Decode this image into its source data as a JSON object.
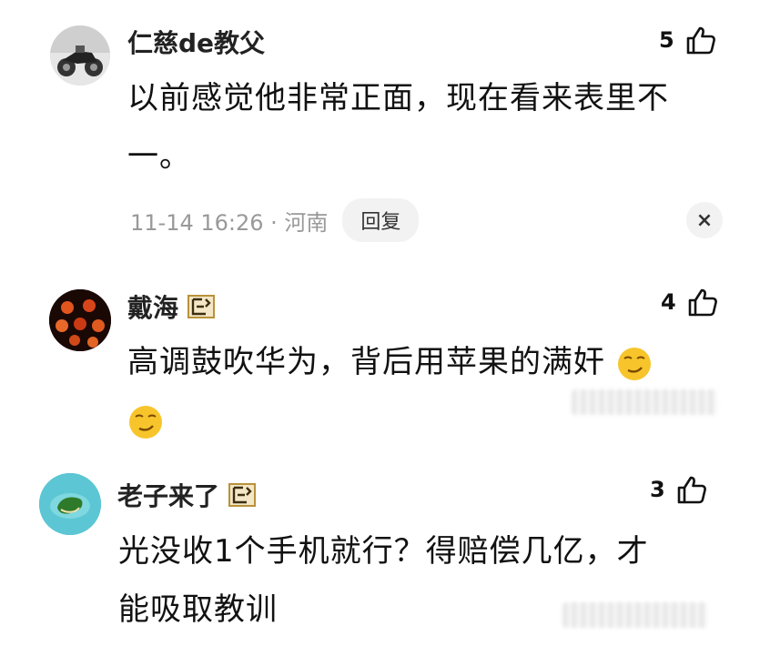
{
  "comments": [
    {
      "username": "仁慈de教父",
      "likes": "5",
      "text_line1": "以前感觉他非常正面，现在看来表里不",
      "text_line2": "一。",
      "timestamp": "11-14 16:26 · 河南",
      "reply_label": "回复",
      "close_symbol": "×",
      "avatar_icon": "motorcycle-photo"
    },
    {
      "username": "戴海",
      "likes": "4",
      "text_line1": "高调鼓吹华为，背后用苹果的满奸",
      "avatar_icon": "lanterns-photo",
      "emoji": "smirk-emoji"
    },
    {
      "username": "老子来了",
      "likes": "3",
      "text_line1": "光没收1个手机就行？得赔偿几亿，才",
      "text_line2": "能吸取教训",
      "avatar_icon": "island-photo"
    }
  ],
  "colors": {
    "meta_text": "#999999",
    "button_bg": "#f2f2f2",
    "badge_gold": "#b8923a"
  }
}
